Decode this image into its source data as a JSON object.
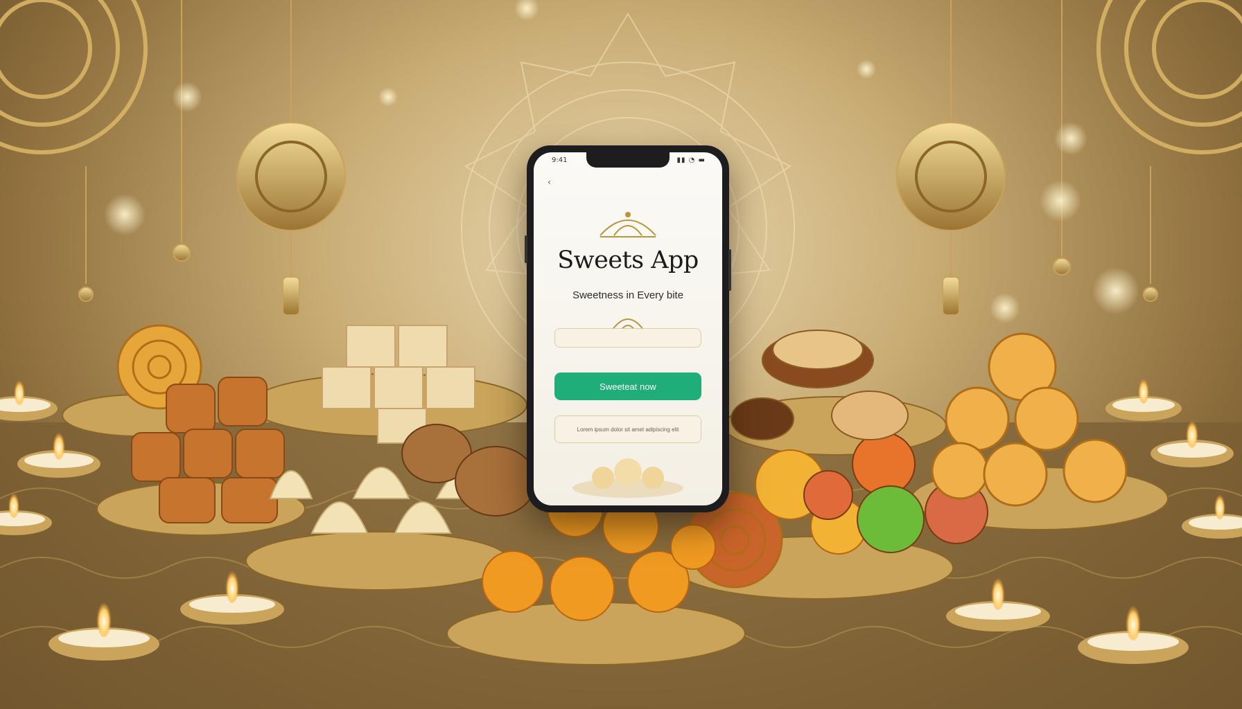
{
  "app": {
    "title": "Sweets App",
    "tagline": "Sweetness in Every bite",
    "status_time": "9:41",
    "status_icons": "▮▮ ◔ ▬",
    "back_icon": "back-arrow-icon",
    "input_placeholder": "",
    "button_label": "Sweeteat now",
    "secondary_field_text": "Lorem ipsum dolor sit amet adipiscing elit"
  },
  "colors": {
    "accent": "#1fae7a",
    "gold": "#c9a45a",
    "background": "#c9ac74"
  }
}
